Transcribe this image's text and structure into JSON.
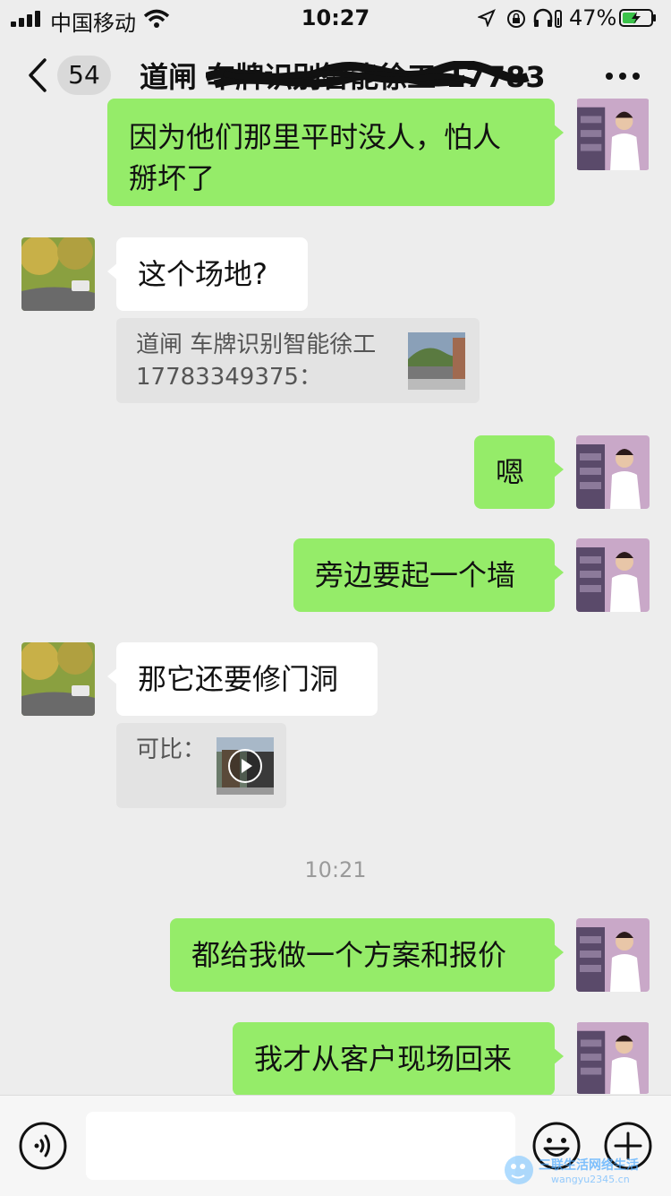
{
  "status_bar": {
    "carrier": "中国移动",
    "time": "10:27",
    "battery_percent": "47%"
  },
  "nav": {
    "unread_count": "54",
    "title": "道闸 车牌识别智能徐工 17783"
  },
  "messages": [
    {
      "id": "m1",
      "side": "out",
      "text": "因为他们那里平时没人，怕人\n掰坏了"
    },
    {
      "id": "m2",
      "side": "in",
      "text": "这个场地?"
    },
    {
      "id": "q1",
      "type": "quote",
      "text": "道闸 车牌识别智能徐工\n17783349375："
    },
    {
      "id": "m3",
      "side": "out",
      "text": "嗯"
    },
    {
      "id": "m4",
      "side": "out",
      "text": "旁边要起一个墙"
    },
    {
      "id": "m5",
      "side": "in",
      "text": "那它还要修门洞"
    },
    {
      "id": "q2",
      "type": "quote",
      "text": "可比："
    },
    {
      "id": "t1",
      "type": "time",
      "text": "10:21"
    },
    {
      "id": "m6",
      "side": "out",
      "text": "都给我做一个方案和报价"
    },
    {
      "id": "m7",
      "side": "out",
      "text": "我才从客户现场回来"
    }
  ],
  "input_bar": {
    "placeholder": ""
  },
  "watermark": {
    "text": "三联生活网络生活",
    "url": "wangyu2345.cn"
  },
  "icons": {
    "back": "chevron-left-icon",
    "more": "more-dots-icon",
    "voice": "voice-icon",
    "emoji": "emoji-icon",
    "plus": "plus-icon",
    "video": "play-icon"
  },
  "colors": {
    "background": "#ededed",
    "outgoing_bubble": "#95ec69",
    "incoming_bubble": "#ffffff",
    "quote_bg": "#e3e3e3",
    "timestamp": "#9a9a9a"
  }
}
